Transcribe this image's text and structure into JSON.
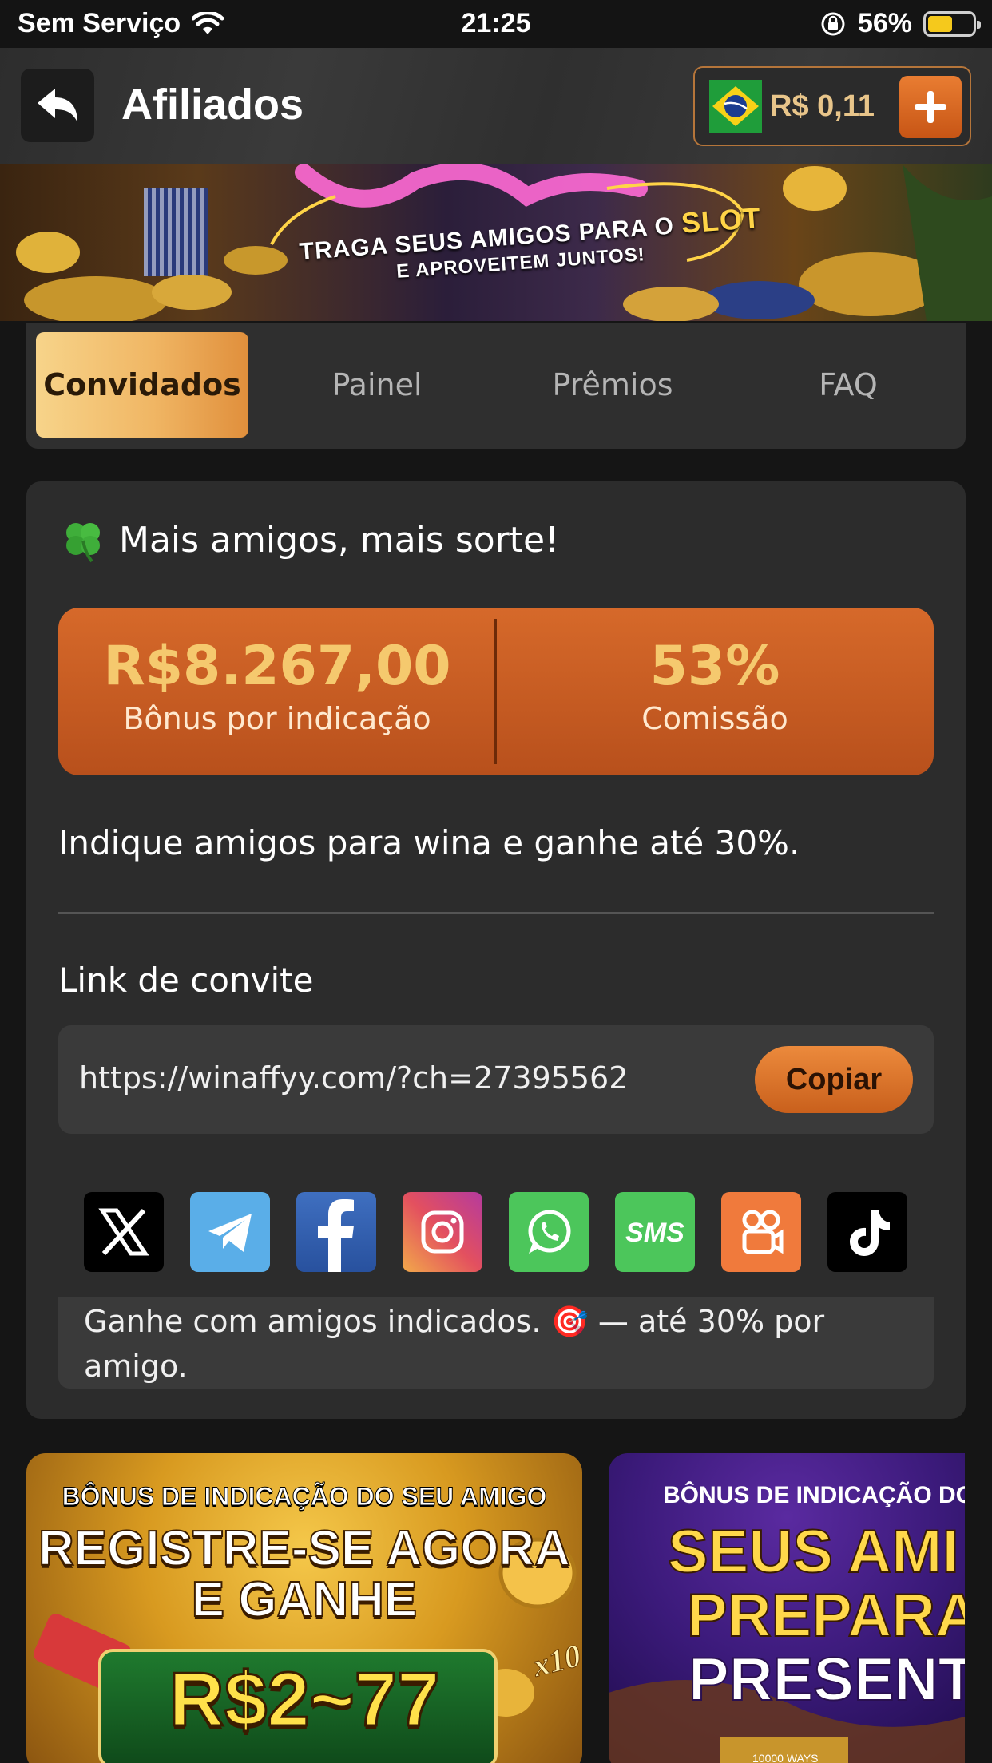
{
  "status_bar": {
    "carrier": "Sem Serviço",
    "time": "21:25",
    "battery": "56%",
    "battery_level": 0.56
  },
  "header": {
    "title": "Afiliados",
    "balance": "R$ 0,11",
    "back_icon": "back-arrow-icon",
    "add_icon": "plus-icon"
  },
  "banner": {
    "line1": "TRAGA SEUS AMIGOS PARA O",
    "line1_highlight": "SLOT",
    "line2": "E APROVEITEM JUNTOS!"
  },
  "tabs": [
    {
      "label": "Convidados",
      "active": true
    },
    {
      "label": "Painel",
      "active": false
    },
    {
      "label": "Prêmios",
      "active": false
    },
    {
      "label": "FAQ",
      "active": false
    }
  ],
  "card": {
    "title": "Mais amigos, mais sorte!",
    "title_icon": "clover-icon",
    "stats": [
      {
        "value": "R$8.267,00",
        "label": "Bônus por indicação"
      },
      {
        "value": "53%",
        "label": "Comissão"
      }
    ],
    "invite_text": "Indique amigos para wina e ganhe até 30%.",
    "link_label": "Link de convite",
    "link_url": "https://winaffyy.com/?ch=27395562",
    "copy_label": "Copiar",
    "socials": [
      "x-icon",
      "telegram-icon",
      "facebook-icon",
      "instagram-icon",
      "whatsapp-icon",
      "sms-icon",
      "kwai-icon",
      "tiktok-icon"
    ],
    "sms_label": "SMS",
    "note_line1": "Ganhe com amigos indicados. 🎯 — até 30% por",
    "note_line2": "amigo."
  },
  "promos": [
    {
      "line1": "BÔNUS DE INDICAÇÃO DO SEU AMIGO",
      "line2": "REGISTRE-SE AGORA",
      "line3": "E GANHE",
      "line4": "R$2~77",
      "badge": "x10"
    },
    {
      "line1": "BÔNUS DE INDICAÇÃO DO",
      "line2": "SEUS AMI",
      "line3": "PREPARAI",
      "line4": "PRESENT",
      "tag": "10000 WAYS"
    }
  ],
  "colors": {
    "accent_orange": "#d6692a",
    "gold": "#f5c96e",
    "tab_active": "#f0b664",
    "card_bg": "#2c2c2c",
    "page_bg": "#151515"
  }
}
